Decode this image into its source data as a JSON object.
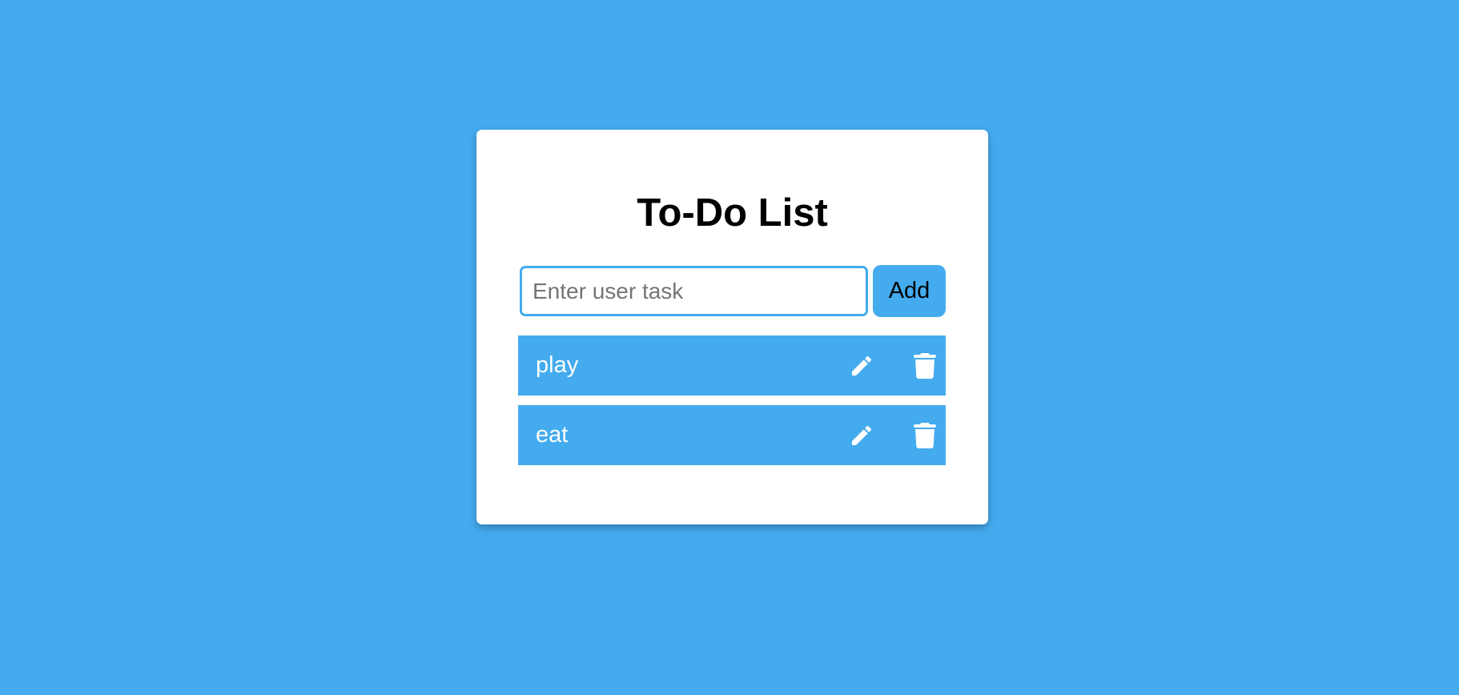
{
  "colors": {
    "background": "#44abef",
    "card": "#ffffff",
    "accent": "#44abef",
    "task_text": "#ffffff"
  },
  "app": {
    "title": "To-Do List"
  },
  "form": {
    "input_value": "",
    "input_placeholder": "Enter user task",
    "add_label": "Add"
  },
  "tasks": [
    {
      "text": "play",
      "edit_icon": "pencil-icon",
      "delete_icon": "trash-icon"
    },
    {
      "text": "eat",
      "edit_icon": "pencil-icon",
      "delete_icon": "trash-icon"
    }
  ]
}
